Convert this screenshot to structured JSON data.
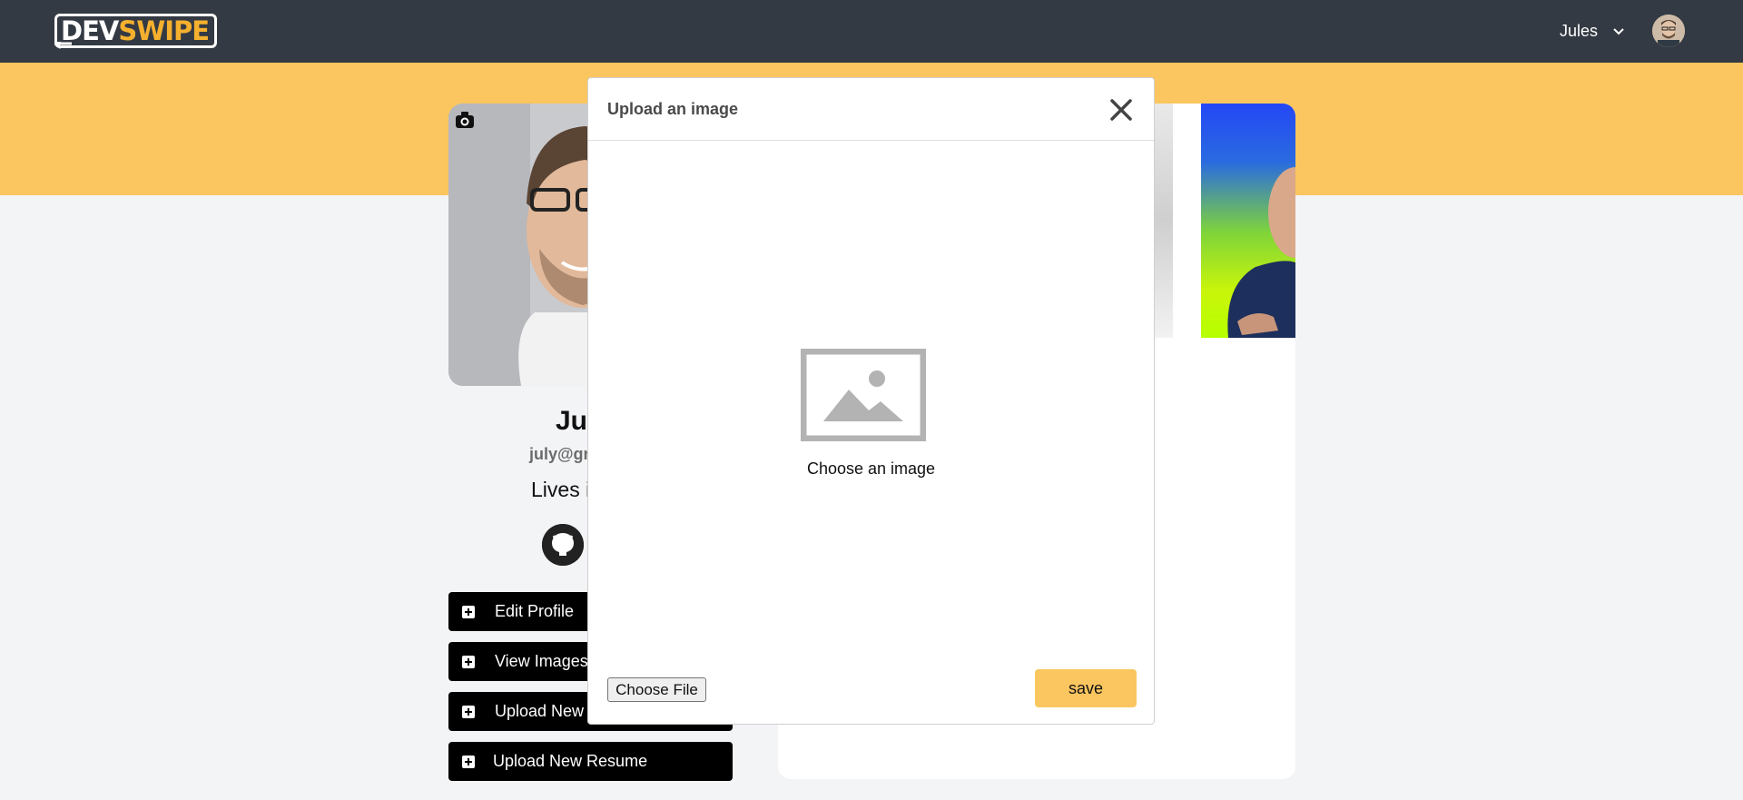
{
  "header": {
    "logo_dev": "DEV",
    "logo_swipe": "SWIPE",
    "user_name": "Jules"
  },
  "profile": {
    "name": "Ju",
    "email": "july@gr",
    "lives": "Lives i"
  },
  "sidebar": {
    "buttons": [
      {
        "label": "Edit Profile"
      },
      {
        "label": "View Images"
      },
      {
        "label": "Upload New I"
      },
      {
        "label": "Upload New Resume"
      }
    ]
  },
  "modal": {
    "title": "Upload an image",
    "choose_text": "Choose an image",
    "file_button": "Choose File",
    "save_button": "save"
  },
  "colors": {
    "header_bg": "#343a43",
    "accent_yellow": "#fbc65f",
    "page_bg": "#f3f4f6"
  }
}
